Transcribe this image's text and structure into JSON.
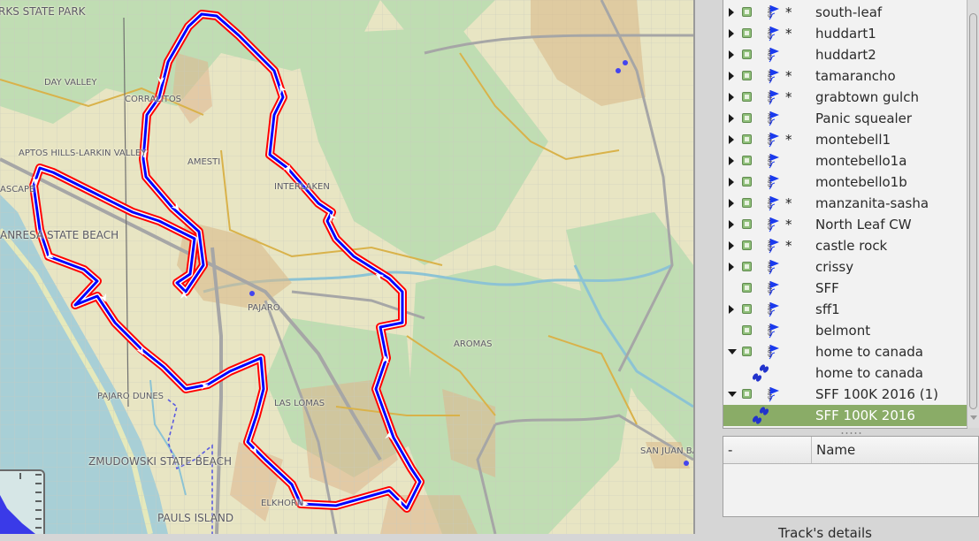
{
  "map": {
    "labels": {
      "park": "RKS STATE PARK",
      "day_valley": "DAY VALLEY",
      "corralitos": "CORRALITOS",
      "aptos": "APTOS HILLS-LARKIN VALLEY",
      "amesti": "AMESTI",
      "rio_del_mar": "ASCAPE",
      "manresa": "ANRESA STATE BEACH",
      "interlaken": "INTERLAKEN",
      "pajaro": "PAJARO",
      "pajaro_dunes": "PAJARO DUNES",
      "aromas": "AROMAS",
      "las_lomas": "LAS LOMAS",
      "zmudowski": "ZMUDOWSKI STATE BEACH",
      "elkhorn": "ELKHORN",
      "pauls_island": "PAULS ISLAND",
      "san_juan": "SAN JUAN BAU"
    },
    "track_colors": {
      "outline": "#ff0000",
      "inner": "#0000ff",
      "halo": "#ffffff"
    }
  },
  "layers": {
    "items": [
      {
        "label": "south-leaf",
        "expandable": true,
        "expanded": false,
        "modified": true,
        "type": "gpx"
      },
      {
        "label": "huddart1",
        "expandable": true,
        "expanded": false,
        "modified": true,
        "type": "gpx"
      },
      {
        "label": "huddart2",
        "expandable": true,
        "expanded": false,
        "modified": false,
        "type": "gpx"
      },
      {
        "label": "tamarancho",
        "expandable": true,
        "expanded": false,
        "modified": true,
        "type": "gpx"
      },
      {
        "label": "grabtown gulch",
        "expandable": true,
        "expanded": false,
        "modified": true,
        "type": "gpx"
      },
      {
        "label": "Panic squealer",
        "expandable": true,
        "expanded": false,
        "modified": false,
        "type": "gpx"
      },
      {
        "label": "montebell1",
        "expandable": true,
        "expanded": false,
        "modified": true,
        "type": "gpx"
      },
      {
        "label": "montebello1a",
        "expandable": true,
        "expanded": false,
        "modified": false,
        "type": "gpx"
      },
      {
        "label": "montebello1b",
        "expandable": true,
        "expanded": false,
        "modified": false,
        "type": "gpx"
      },
      {
        "label": "manzanita-sasha",
        "expandable": true,
        "expanded": false,
        "modified": true,
        "type": "gpx"
      },
      {
        "label": "North Leaf CW",
        "expandable": true,
        "expanded": false,
        "modified": true,
        "type": "gpx"
      },
      {
        "label": "castle rock",
        "expandable": true,
        "expanded": false,
        "modified": true,
        "type": "gpx"
      },
      {
        "label": "crissy",
        "expandable": true,
        "expanded": false,
        "modified": false,
        "type": "gpx"
      },
      {
        "label": "SFF",
        "expandable": false,
        "expanded": false,
        "modified": false,
        "type": "gpx"
      },
      {
        "label": "sff1",
        "expandable": true,
        "expanded": false,
        "modified": false,
        "type": "gpx"
      },
      {
        "label": "belmont",
        "expandable": false,
        "expanded": false,
        "modified": false,
        "type": "gpx"
      },
      {
        "label": "home to canada",
        "expandable": true,
        "expanded": true,
        "modified": false,
        "type": "gpx"
      },
      {
        "label": "home to canada",
        "expandable": false,
        "expanded": false,
        "modified": false,
        "type": "track"
      },
      {
        "label": "SFF 100K 2016 (1)",
        "expandable": true,
        "expanded": true,
        "modified": false,
        "type": "gpx"
      },
      {
        "label": "SFF 100K 2016",
        "expandable": false,
        "expanded": false,
        "modified": false,
        "type": "track",
        "selected": true
      }
    ],
    "modified_marker": "*",
    "selected_color": "#8aac67"
  },
  "details": {
    "columns": [
      "-",
      "Name"
    ],
    "bottom_label": "Track's details"
  }
}
